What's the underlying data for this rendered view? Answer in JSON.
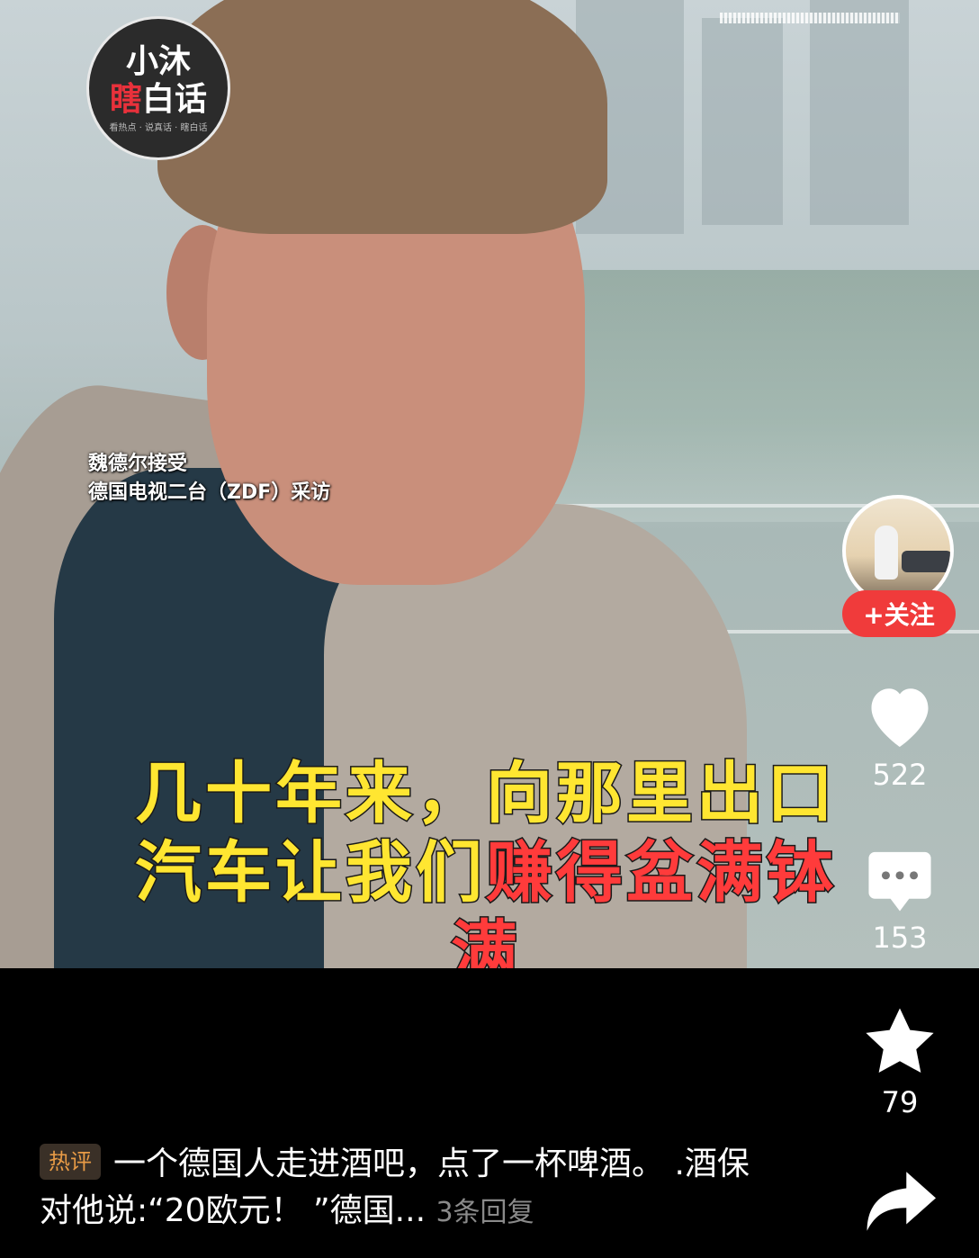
{
  "video": {
    "logo_line1": "小沐",
    "logo_line2_red": "瞎",
    "logo_line2_white": "白话",
    "logo_small": "看热点 · 说真话 · 瞎白话",
    "caption_line1": "魏德尔接受",
    "caption_line2": "德国电视二台（ZDF）采访",
    "subtitle_line1": "几十年来，向那里出口",
    "subtitle_line2_yellow": "汽车让我们",
    "subtitle_line2_red": "赚得盆满钵",
    "subtitle_line3_red": "满"
  },
  "rail": {
    "follow_label": "+关注",
    "likes": "522",
    "comments": "153",
    "favorites": "79"
  },
  "comment": {
    "tag": "热评",
    "text": "一个德国人走进酒吧，点了一杯啤酒。 .酒保对他说:“20欧元！ ”德国...",
    "replies": "3条回复"
  },
  "icons": {
    "like": "heart-icon",
    "comment": "speech-bubble-icon",
    "favorite": "star-icon",
    "share": "share-arrow-icon"
  }
}
